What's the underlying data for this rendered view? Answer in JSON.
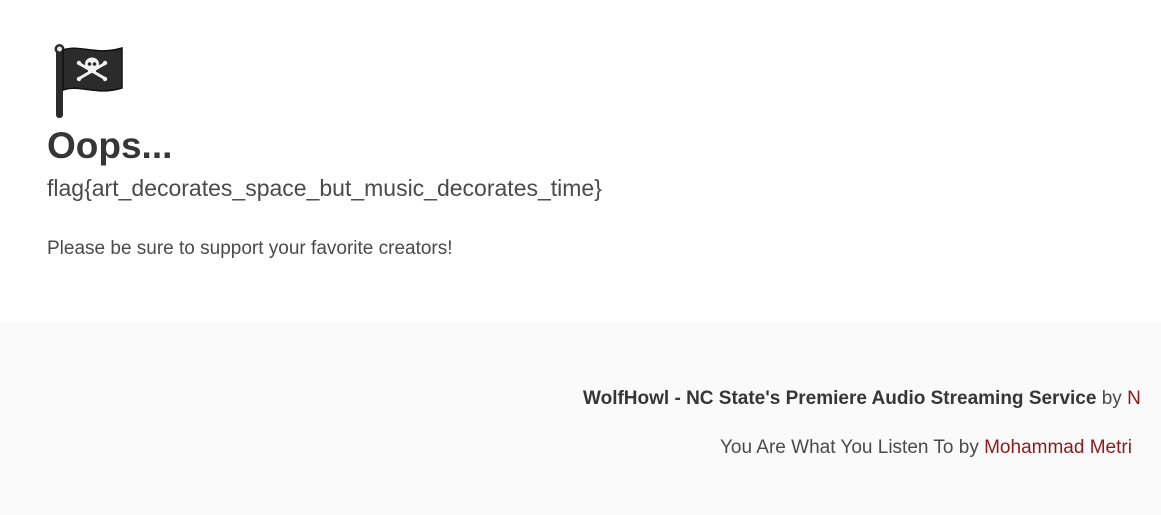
{
  "main": {
    "icon": "pirate-flag-icon",
    "title": "Oops...",
    "flag": "flag{art_decorates_space_but_music_decorates_time}",
    "message": "Please be sure to support your favorite creators!"
  },
  "footer": {
    "line1": {
      "brand": "WolfHowl - NC State's Premiere Audio Streaming Service",
      "by": "by",
      "author_link": "N"
    },
    "line2": {
      "text": "You Are What You Listen To",
      "by": "by",
      "author_link": "Mohammad Metri"
    }
  },
  "colors": {
    "link": "#8b1a1a",
    "text": "#4a4a4a",
    "heading": "#363636",
    "footer_bg": "#fafafa"
  }
}
